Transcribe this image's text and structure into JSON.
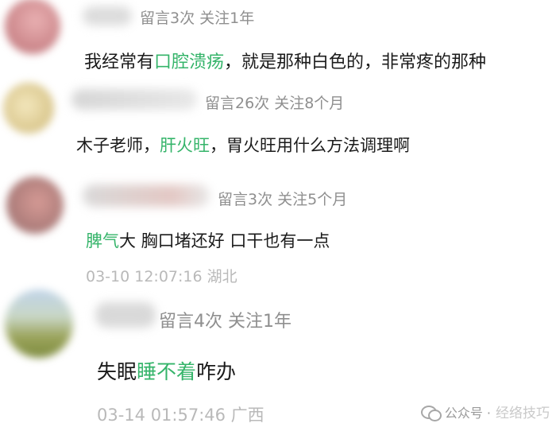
{
  "comments": [
    {
      "meta": "留言3次 关注1年",
      "message_parts": [
        {
          "text": "我经常有",
          "highlight": false
        },
        {
          "text": "口腔溃疡",
          "highlight": true
        },
        {
          "text": "，就是那种白色的，非常疼的那种",
          "highlight": false
        }
      ],
      "time": ""
    },
    {
      "meta": "留言26次 关注8个月",
      "message_parts": [
        {
          "text": "木子老师，",
          "highlight": false
        },
        {
          "text": "肝火旺",
          "highlight": true
        },
        {
          "text": "，胃火旺用什么方法调理啊",
          "highlight": false
        }
      ],
      "time": ""
    },
    {
      "meta": "留言3次 关注5个月",
      "message_parts": [
        {
          "text": "脾气",
          "highlight": true
        },
        {
          "text": "大 胸口堵还好 口干也有一点",
          "highlight": false
        }
      ],
      "time": "03-10 12:07:16 湖北"
    },
    {
      "meta": "留言4次 关注1年",
      "message_parts": [
        {
          "text": "失眠",
          "highlight": false
        },
        {
          "text": "睡不着",
          "highlight": true
        },
        {
          "text": "咋办",
          "highlight": false
        }
      ],
      "time": "03-14 01:57:46 广西"
    }
  ],
  "watermark": {
    "label": "公众号 ·",
    "account": "经络技巧"
  },
  "colors": {
    "highlight": "#35b46a",
    "meta": "#8f8f8f",
    "time": "#b9b9b9"
  }
}
